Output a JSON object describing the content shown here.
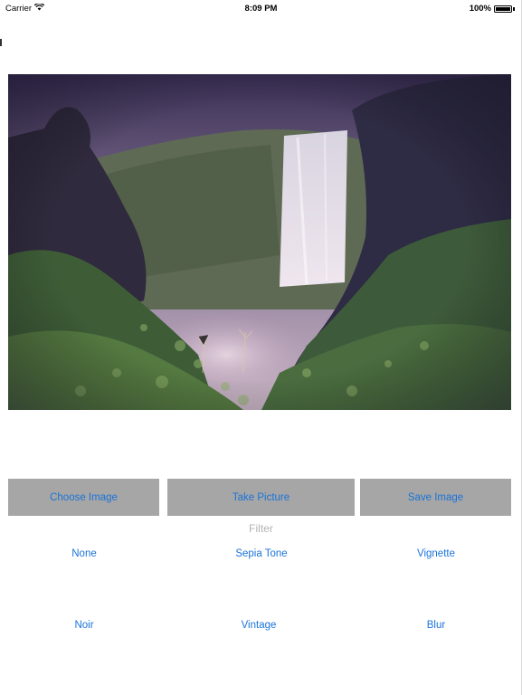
{
  "status_bar": {
    "carrier": "Carrier",
    "time": "8:09 PM",
    "battery_text": "100%",
    "icons": [
      "wifi-icon",
      "battery-icon"
    ]
  },
  "photo": {
    "subject": "waterfall-photo"
  },
  "actions": {
    "choose_label": "Choose Image",
    "take_label": "Take Picture",
    "save_label": "Save Image"
  },
  "filter": {
    "title": "Filter",
    "options": [
      "None",
      "Sepia Tone",
      "Vignette",
      "Noir",
      "Vintage",
      "Blur"
    ]
  },
  "colors": {
    "accent": "#1a73d9",
    "button_bg": "#a6a6a6",
    "muted_text": "#b3b3b3"
  }
}
